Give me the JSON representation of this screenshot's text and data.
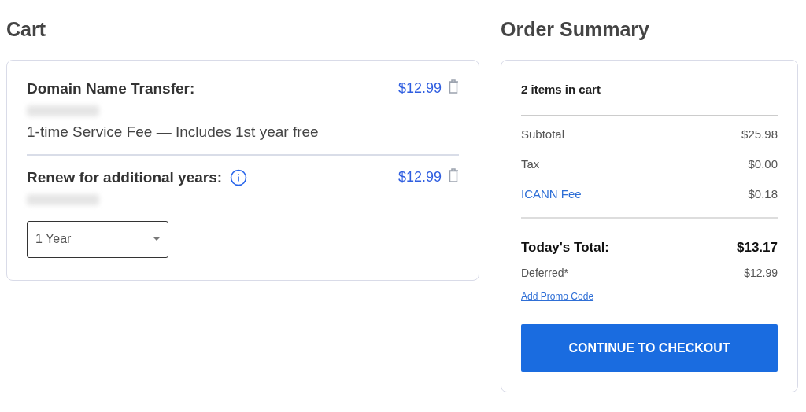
{
  "cart": {
    "title": "Cart",
    "items": [
      {
        "title": "Domain Name Transfer:",
        "info": false,
        "price": "$12.99",
        "note": "1-time Service Fee — Includes 1st year free"
      },
      {
        "title": "Renew for additional years:",
        "info": true,
        "price": "$12.99",
        "select": {
          "value": "1 Year"
        }
      }
    ]
  },
  "summary": {
    "title": "Order Summary",
    "count": "2 items in cart",
    "lines": [
      {
        "kind": "plain",
        "label": "Subtotal",
        "value": "$25.98"
      },
      {
        "kind": "plain",
        "label": "Tax",
        "value": "$0.00"
      },
      {
        "kind": "link",
        "label": "ICANN Fee",
        "value": "$0.18"
      }
    ],
    "total": {
      "label": "Today's Total:",
      "value": "$13.17"
    },
    "deferred": {
      "label": "Deferred*",
      "value": "$12.99"
    },
    "promo_link": "Add Promo Code",
    "checkout_button": "CONTINUE TO CHECKOUT"
  }
}
